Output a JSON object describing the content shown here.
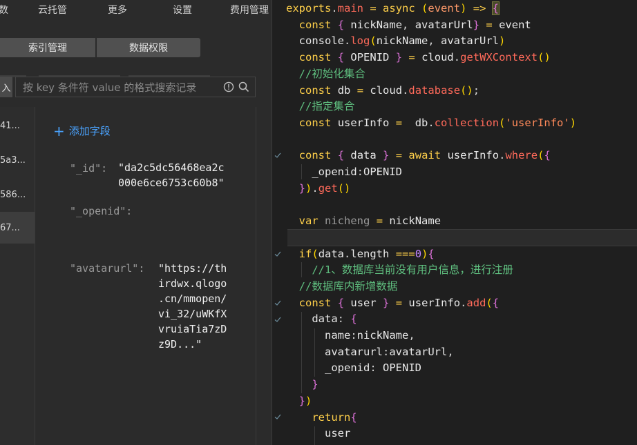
{
  "menu": {
    "items": [
      "数",
      "云托管",
      "更多",
      "设置",
      "费用管理"
    ]
  },
  "tabs": {
    "index_label": "索引管理",
    "perm_label": "数据权限"
  },
  "search": {
    "left_button_label": "入",
    "placeholder": "按 key 条件符 value 的格式搜索记录"
  },
  "records": [
    "41...",
    "5a3...",
    "586...",
    "67..."
  ],
  "detail": {
    "add_field_label": "添加字段",
    "fields": [
      {
        "key": "\"_id\":",
        "value": "\"da2c5dc56468ea2c\n000e6ce6753c60b8\""
      },
      {
        "key": "\"_openid\":",
        "value": ""
      },
      {
        "key": "\"avatarurl\":",
        "value": "\"https://th\nirdwx.qlogo\n.cn/mmopen/\nvi_32/uWKfX\nvruiaTia7zD\nz9D...\""
      }
    ]
  },
  "code": {
    "lines": [
      "exports.main = async (event) => {",
      "  const { nickName, avatarUrl} = event",
      "  console.log(nickName, avatarUrl)",
      "  const { OPENID } = cloud.getWXContext()",
      "  //初始化集合",
      "  const db = cloud.database();",
      "  //指定集合",
      "  const userInfo =  db.collection('userInfo')",
      "",
      "  const { data } = await userInfo.where({",
      "    _openid:OPENID",
      "  }).get()",
      "",
      "  var nicheng = nickName",
      "",
      "  if(data.length ===0){",
      "    //1、数据库当前没有用户信息，进行注册",
      "  //数据库内新增数据",
      "  const { user } = userInfo.add({",
      "    data: {",
      "      name:nickName,",
      "      avatarurl:avatarUrl,",
      "      _openid: OPENID",
      "    }",
      "  })",
      "    return{",
      "      user"
    ]
  },
  "colors": {
    "accent": "#4aa3ff",
    "keyword": "#ffd04a",
    "function": "#ff6a5a",
    "comment": "#5fbf7f",
    "string": "#ff8a5a"
  }
}
